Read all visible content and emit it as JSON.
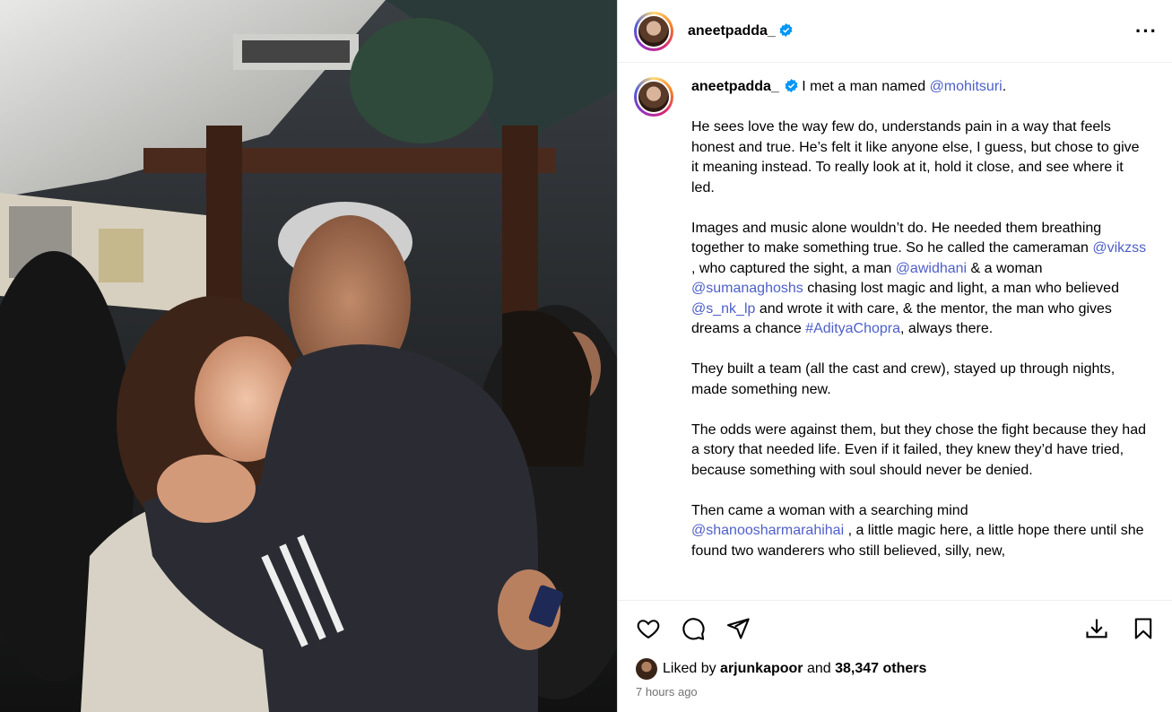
{
  "post": {
    "username": "aneetpadda_",
    "more_icon": "more-horizontal-icon",
    "caption": {
      "username": "aneetpadda_",
      "line1_text": "I met a man named ",
      "line1_mention": "@mohitsuri",
      "line1_end": ".",
      "p2": "He sees love the way few do, understands pain in a way that feels honest and true. He’s felt it like anyone else, I guess, but chose to give it meaning instead. To really look at it, hold it close, and see where it led.",
      "p3_a": "Images and music alone wouldn’t do. He needed them breathing together to make something true. So he called the cameraman ",
      "p3_m1": "@vikzss",
      "p3_b": " , who captured the sight, a man ",
      "p3_m2": "@awidhani",
      "p3_c": " & a woman ",
      "p3_m3": "@sumanaghoshs",
      "p3_d": " chasing lost magic and light, a man who believed ",
      "p3_m4": "@s_nk_lp",
      "p3_e": " and wrote it with care, & the mentor, the man who gives dreams a chance ",
      "p3_m5": "#AdityaChopra",
      "p3_f": ", always there.",
      "p4": "They built a team (all the cast and crew), stayed up through nights, made something new.",
      "p5_a": "The odds were against them, but they chose the fight because they had a story that needed life. Even if it failed, they knew they’d have tried,",
      "p5_b": "because something with soul should never be denied.",
      "p6_a": "Then came a woman with a searching mind",
      "p6_m": "@shanoosharmarahihai",
      "p6_b": " , a little magic here, a little hope there until she found two wanderers who still believed, silly, new,"
    },
    "actions": {
      "like_icon": "heart-icon",
      "comment_icon": "comment-icon",
      "share_icon": "send-icon",
      "download_icon": "download-icon",
      "save_icon": "bookmark-icon"
    },
    "likes": {
      "prefix": "Liked by ",
      "user": "arjunkapoor",
      "middle": " and ",
      "count": "38,347 others"
    },
    "time_ago": "7 hours ago"
  },
  "colors": {
    "link": "#4e5fc9",
    "verified": "#0095f6",
    "muted": "#737373"
  }
}
